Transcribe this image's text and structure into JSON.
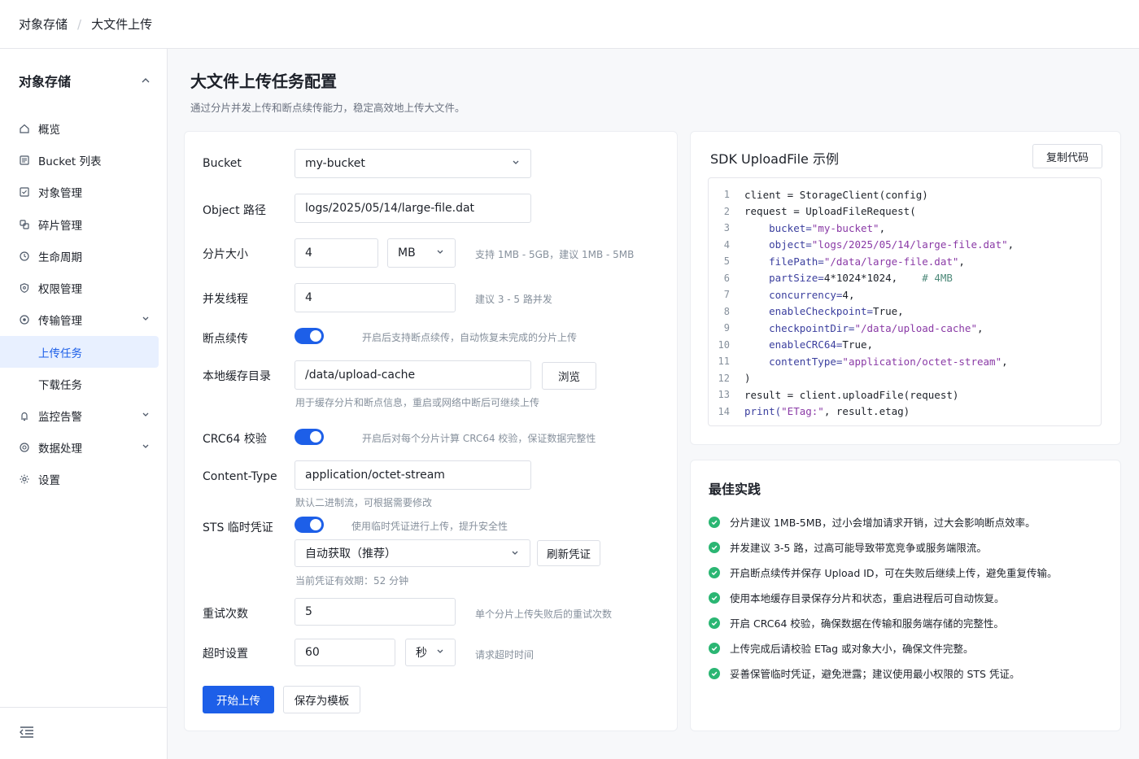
{
  "breadcrumb": {
    "root": "对象存储",
    "separator": "/",
    "current": "大文件上传"
  },
  "sidebar": {
    "title": "对象存储",
    "items": [
      {
        "label": "概览",
        "icon": "home-icon"
      },
      {
        "label": "Bucket 列表",
        "icon": "list-icon"
      },
      {
        "label": "对象管理",
        "icon": "file-icon"
      },
      {
        "label": "碎片管理",
        "icon": "fragment-icon"
      },
      {
        "label": "生命周期",
        "icon": "clock-icon"
      },
      {
        "label": "权限管理",
        "icon": "shield-icon"
      },
      {
        "label": "传输管理",
        "icon": "transfer-icon"
      }
    ],
    "sub_items": [
      {
        "label": "上传任务",
        "active": true
      },
      {
        "label": "下载任务",
        "active": false
      }
    ],
    "items_after": [
      {
        "label": "监控告警",
        "icon": "bell-icon"
      },
      {
        "label": "数据处理",
        "icon": "process-icon"
      },
      {
        "label": "设置",
        "icon": "gear-icon"
      }
    ]
  },
  "page": {
    "title": "大文件上传任务配置",
    "description": "通过分片并发上传和断点续传能力，稳定高效地上传大文件。"
  },
  "form": {
    "bucket": {
      "label": "Bucket",
      "value": "my-bucket"
    },
    "object_path": {
      "label": "Object 路径",
      "value": "logs/2025/05/14/large-file.dat"
    },
    "part_size": {
      "label": "分片大小",
      "value": "4",
      "unit": "MB",
      "hint": "支持 1MB - 5GB，建议 1MB - 5MB"
    },
    "threads": {
      "label": "并发线程",
      "value": "4",
      "hint": "建议 3 - 5 路并发"
    },
    "checkpoint": {
      "label": "断点续传",
      "enabled": true,
      "hint": "开启后支持断点续传，自动恢复未完成的分片上传"
    },
    "cache_dir": {
      "label": "本地缓存目录",
      "value": "/data/upload-cache",
      "browse": "浏览",
      "hint": "用于缓存分片和断点信息，重启或网络中断后可继续上传"
    },
    "crc64": {
      "label": "CRC64 校验",
      "enabled": true,
      "hint": "开启后对每个分片计算 CRC64 校验，保证数据完整性"
    },
    "content_type": {
      "label": "Content-Type",
      "value": "application/octet-stream",
      "hint": "默认二进制流，可根据需要修改"
    },
    "sts": {
      "label": "STS 临时凭证",
      "enabled": true,
      "hint": "使用临时凭证进行上传，提升安全性",
      "mode": "自动获取（推荐）",
      "refresh": "刷新凭证",
      "validity": "当前凭证有效期：52 分钟"
    },
    "retry": {
      "label": "重试次数",
      "value": "5",
      "hint": "单个分片上传失败后的重试次数"
    },
    "timeout": {
      "label": "超时设置",
      "value": "60",
      "unit": "秒",
      "hint": "请求超时时间"
    },
    "start": "开始上传",
    "save_template": "保存为模板"
  },
  "sdk": {
    "title": "SDK UploadFile 示例",
    "copy": "复制代码",
    "lines": [
      {
        "n": "1",
        "parts": [
          [
            "var",
            "client = StorageClient(config)"
          ]
        ]
      },
      {
        "n": "2",
        "parts": [
          [
            "var",
            "request = UploadFileRequest("
          ]
        ]
      },
      {
        "n": "3",
        "parts": [
          [
            "id",
            "    bucket="
          ],
          [
            "str",
            "\"my-bucket\""
          ],
          [
            "var",
            ","
          ]
        ]
      },
      {
        "n": "4",
        "parts": [
          [
            "id",
            "    object="
          ],
          [
            "str",
            "\"logs/2025/05/14/large-file.dat\""
          ],
          [
            "var",
            ","
          ]
        ]
      },
      {
        "n": "5",
        "parts": [
          [
            "id",
            "    filePath="
          ],
          [
            "str",
            "\"/data/large-file.dat\""
          ],
          [
            "var",
            ","
          ]
        ]
      },
      {
        "n": "6",
        "parts": [
          [
            "id",
            "    partSize="
          ],
          [
            "num",
            "4*1024*1024"
          ],
          [
            "var",
            ",    "
          ],
          [
            "com",
            "# 4MB"
          ]
        ]
      },
      {
        "n": "7",
        "parts": [
          [
            "id",
            "    concurrency="
          ],
          [
            "num",
            "4"
          ],
          [
            "var",
            ","
          ]
        ]
      },
      {
        "n": "8",
        "parts": [
          [
            "id",
            "    enableCheckpoint="
          ],
          [
            "num",
            "True"
          ],
          [
            "var",
            ","
          ]
        ]
      },
      {
        "n": "9",
        "parts": [
          [
            "id",
            "    checkpointDir="
          ],
          [
            "str",
            "\"/data/upload-cache\""
          ],
          [
            "var",
            ","
          ]
        ]
      },
      {
        "n": "10",
        "parts": [
          [
            "id",
            "    enableCRC64="
          ],
          [
            "num",
            "True"
          ],
          [
            "var",
            ","
          ]
        ]
      },
      {
        "n": "11",
        "parts": [
          [
            "id",
            "    contentType="
          ],
          [
            "str",
            "\"application/octet-stream\""
          ],
          [
            "var",
            ","
          ]
        ]
      },
      {
        "n": "12",
        "parts": [
          [
            "var",
            ")"
          ]
        ]
      },
      {
        "n": "13",
        "parts": [
          [
            "var",
            "result = client.uploadFile(request)"
          ]
        ]
      },
      {
        "n": "14",
        "parts": [
          [
            "id",
            "print("
          ],
          [
            "str",
            "\"ETag:\""
          ],
          [
            "var",
            ", result.etag)"
          ]
        ]
      }
    ]
  },
  "best_practices": {
    "title": "最佳实践",
    "items": [
      "分片建议 1MB-5MB，过小会增加请求开销，过大会影响断点效率。",
      "并发建议 3-5 路，过高可能导致带宽竞争或服务端限流。",
      "开启断点续传并保存 Upload ID，可在失败后继续上传，避免重复传输。",
      "使用本地缓存目录保存分片和状态，重启进程后可自动恢复。",
      "开启 CRC64 校验，确保数据在传输和服务端存储的完整性。",
      "上传完成后请校验 ETag 或对象大小，确保文件完整。",
      "妥善保管临时凭证，避免泄露；建议使用最小权限的 STS 凭证。"
    ]
  },
  "colors": {
    "accent": "#1d5fe8",
    "success": "#2bb673"
  }
}
